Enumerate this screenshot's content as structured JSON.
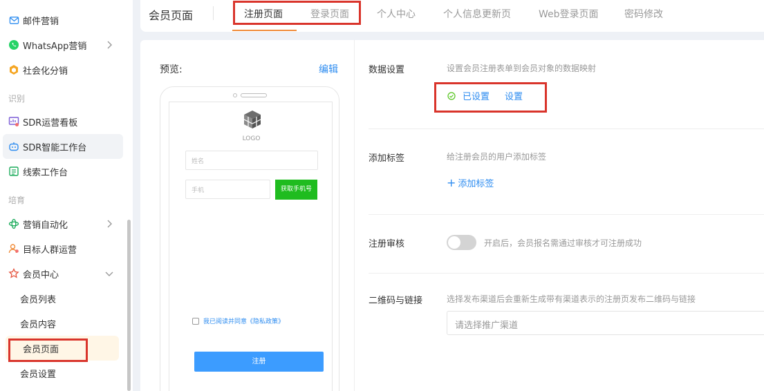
{
  "sidebar": {
    "items": [
      {
        "label": "邮件营销",
        "icon": "mail-icon"
      },
      {
        "label": "WhatsApp营销",
        "icon": "whatsapp-icon"
      },
      {
        "label": "社会化分销",
        "icon": "distribution-icon"
      },
      {
        "label": "SDR运营看板",
        "icon": "dashboard-icon"
      },
      {
        "label": "SDR智能工作台",
        "icon": "robot-icon"
      },
      {
        "label": "线索工作台",
        "icon": "leads-icon"
      },
      {
        "label": "营销自动化",
        "icon": "automation-icon"
      },
      {
        "label": "目标人群运营",
        "icon": "audience-icon"
      },
      {
        "label": "会员中心",
        "icon": "member-icon"
      }
    ],
    "sections": {
      "identify": "识别",
      "cultivate": "培育"
    },
    "sub_items": [
      "会员列表",
      "会员内容",
      "会员页面",
      "会员设置"
    ]
  },
  "tabbar": {
    "title": "会员页面",
    "tabs": [
      "注册页面",
      "登录页面",
      "个人中心",
      "个人信息更新页",
      "Web登录页面",
      "密码修改"
    ]
  },
  "preview": {
    "label": "预览:",
    "edit": "编辑",
    "logo_text": "LOGO",
    "name_placeholder": "姓名",
    "phone_placeholder": "手机",
    "get_code": "获取手机号",
    "agree_text": "我已阅读并同意《隐私政策》",
    "register": "注册"
  },
  "settings": {
    "data": {
      "label": "数据设置",
      "desc": "设置会员注册表单到会员对象的数据映射",
      "status": "已设置",
      "action": "设置"
    },
    "tags": {
      "label": "添加标签",
      "desc": "给注册会员的用户添加标签",
      "action": "添加标签"
    },
    "review": {
      "label": "注册审核",
      "desc": "开启后，会员报名需通过审核才可注册成功",
      "enabled": false
    },
    "qr": {
      "label": "二维码与链接",
      "desc": "选择发布渠道后会重新生成带有渠道表示的注册页发布二维码与链接",
      "placeholder": "请选择推广渠道"
    }
  },
  "colors": {
    "accent": "#2d8cf0",
    "tab_underline": "#f08c3a",
    "highlight": "#d9342b",
    "code_button": "#1fbc1f",
    "register_button": "#3c9cff"
  }
}
